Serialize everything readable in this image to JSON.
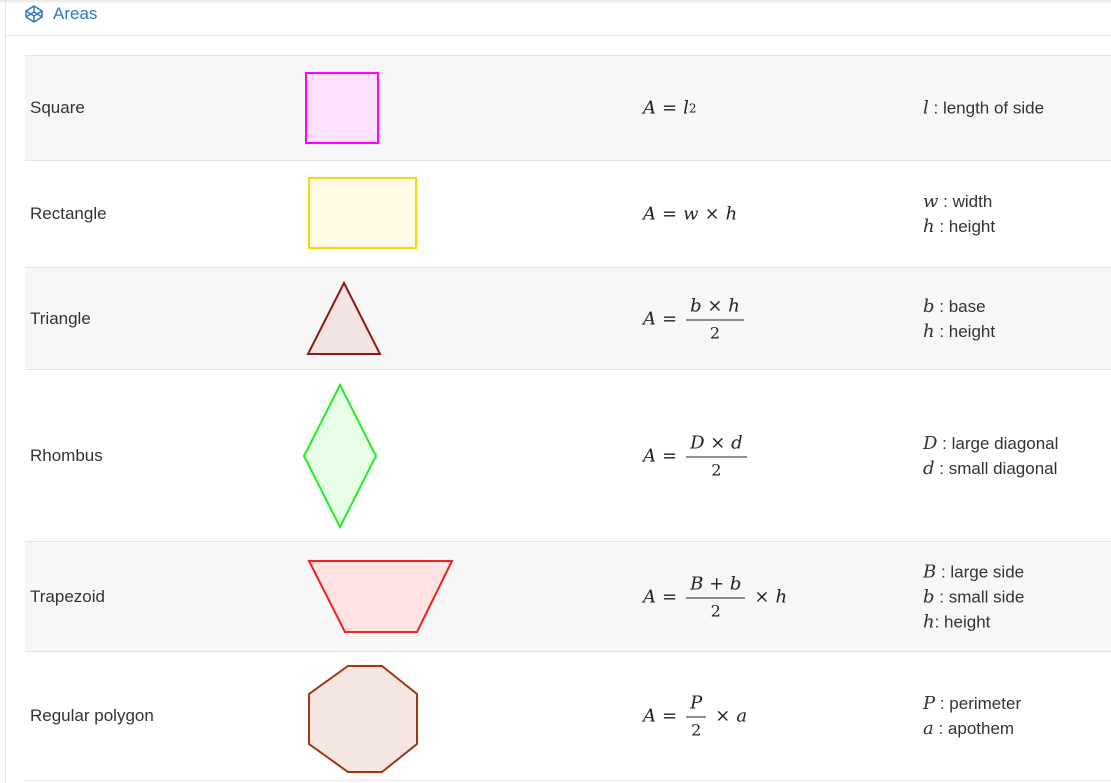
{
  "header": {
    "icon": "codepen-cube-icon",
    "title": "Areas"
  },
  "colors": {
    "title_blue": "#2b7bbf",
    "square": {
      "stroke": "#ff00ff",
      "fill": "#ffe0ff"
    },
    "rectangle": {
      "stroke": "#ffd700",
      "fill": "#fffbe6"
    },
    "triangle": {
      "stroke": "#8b1a1a",
      "fill": "#f3e3e3"
    },
    "rhombus": {
      "stroke": "#22ee22",
      "fill": "#e6ffe6"
    },
    "trapezoid": {
      "stroke": "#ee2222",
      "fill": "#ffe3e3"
    },
    "polygon": {
      "stroke": "#a0380e",
      "fill": "#f5e6e3"
    }
  },
  "rows": [
    {
      "name": "Square",
      "formula": {
        "lhs": "A",
        "eq": "=",
        "base": "l",
        "exp": "2"
      },
      "vars": [
        {
          "sym": "l",
          "sep": " : ",
          "desc": "length of side"
        }
      ]
    },
    {
      "name": "Rectangle",
      "formula": {
        "lhs": "A",
        "eq": "=",
        "a": "w",
        "op": "×",
        "b": "h"
      },
      "vars": [
        {
          "sym": "w",
          "sep": " : ",
          "desc": "width"
        },
        {
          "sym": "h",
          "sep": " : ",
          "desc": "height"
        }
      ]
    },
    {
      "name": "Triangle",
      "formula": {
        "lhs": "A",
        "eq": "=",
        "num_a": "b",
        "num_op": "×",
        "num_b": "h",
        "den": "2"
      },
      "vars": [
        {
          "sym": "b",
          "sep": " : ",
          "desc": "base"
        },
        {
          "sym": "h",
          "sep": " : ",
          "desc": "height"
        }
      ]
    },
    {
      "name": "Rhombus",
      "formula": {
        "lhs": "A",
        "eq": "=",
        "num_a": "D",
        "num_op": "×",
        "num_b": "d",
        "den": "2"
      },
      "vars": [
        {
          "sym": "D",
          "sep": " : ",
          "desc": "large diagonal"
        },
        {
          "sym": "d",
          "sep": " : ",
          "desc": "small diagonal"
        }
      ]
    },
    {
      "name": "Trapezoid",
      "formula": {
        "lhs": "A",
        "eq": "=",
        "num_a": "B",
        "num_op": "+",
        "num_b": "b",
        "den": "2",
        "tail_op": "×",
        "tail": "h"
      },
      "vars": [
        {
          "sym": "B",
          "sep": " : ",
          "desc": "large side"
        },
        {
          "sym": "b",
          "sep": " : ",
          "desc": "small side"
        },
        {
          "sym": "h",
          "sep": ": ",
          "desc": "height"
        }
      ]
    },
    {
      "name": "Regular polygon",
      "formula": {
        "lhs": "A",
        "eq": "=",
        "num": "P",
        "den": "2",
        "tail_op": "×",
        "tail": "a"
      },
      "vars": [
        {
          "sym": "P",
          "sep": " : ",
          "desc": "perimeter"
        },
        {
          "sym": "a",
          "sep": " : ",
          "desc": "apothem"
        }
      ]
    }
  ]
}
